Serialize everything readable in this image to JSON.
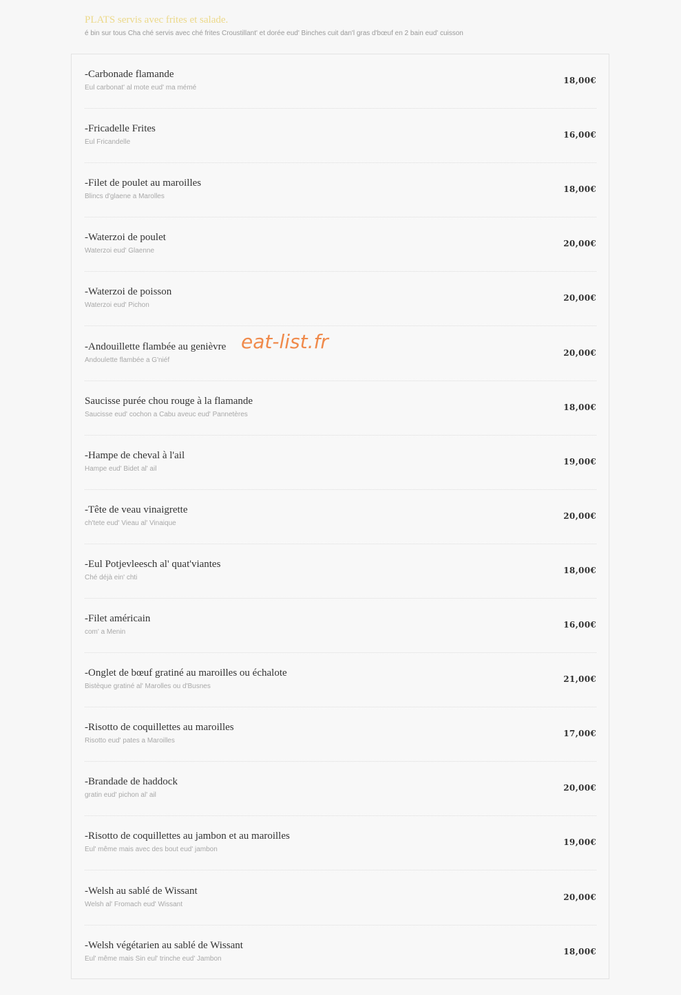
{
  "header": {
    "title": "PLATS servis avec frites et salade.",
    "subtitle": "é bin sur tous Cha ché servis avec ché frites Croustillant' et dorée eud' Binches cuit dan'l gras d'bœuf en 2 bain eud' cuisson"
  },
  "watermark": "eat-list.fr",
  "items": [
    {
      "name": "-Carbonade flamande",
      "desc": "Eul carbonat' al mote eud' ma mémé",
      "price": "18,00€"
    },
    {
      "name": "-Fricadelle Frites",
      "desc": "Eul Fricandelle",
      "price": "16,00€"
    },
    {
      "name": "-Filet de poulet au maroilles",
      "desc": "Blincs d'glaene a Marolles",
      "price": "18,00€"
    },
    {
      "name": "-Waterzoi de poulet",
      "desc": "Waterzoi eud' Glaenne",
      "price": "20,00€"
    },
    {
      "name": "-Waterzoi de poisson",
      "desc": "Waterzoi eud' Pichon",
      "price": "20,00€"
    },
    {
      "name": "-Andouillette flambée au genièvre",
      "desc": "Andoulette flambée a G'niéf",
      "price": "20,00€"
    },
    {
      "name": "Saucisse purée chou rouge à la flamande",
      "desc": "Saucisse eud' cochon a Cabu aveuc eud' Pannetères",
      "price": "18,00€"
    },
    {
      "name": "-Hampe de cheval à l'ail",
      "desc": "Hampe eud' Bidet al' ail",
      "price": "19,00€"
    },
    {
      "name": "-Tête de veau vinaigrette",
      "desc": "ch'tete eud' Vieau al' Vinaique",
      "price": "20,00€"
    },
    {
      "name": "-Eul Potjevleesch al' quat'viantes",
      "desc": "Ché déjà ein' chti",
      "price": "18,00€"
    },
    {
      "name": "-Filet américain",
      "desc": "com' a Menin",
      "price": "16,00€"
    },
    {
      "name": "-Onglet de bœuf gratiné au maroilles ou échalote",
      "desc": "Bistèque gratiné al' Marolles ou d'Busnes",
      "price": "21,00€"
    },
    {
      "name": "-Risotto de coquillettes au maroilles",
      "desc": "Risotto eud' pates a Maroilles",
      "price": "17,00€"
    },
    {
      "name": "-Brandade de haddock",
      "desc": "gratin eud' pichon al' ail",
      "price": "20,00€"
    },
    {
      "name": "-Risotto de coquillettes au jambon et au maroilles",
      "desc": "Eul' même mais avec des bout eud' jambon",
      "price": "19,00€"
    },
    {
      "name": "-Welsh au sablé de Wissant",
      "desc": "Welsh al' Fromach eud' Wissant",
      "price": "20,00€"
    },
    {
      "name": "-Welsh végétarien au sablé de Wissant",
      "desc": "Eul' même mais Sin eul' trinche eud' Jambon",
      "price": "18,00€"
    }
  ]
}
